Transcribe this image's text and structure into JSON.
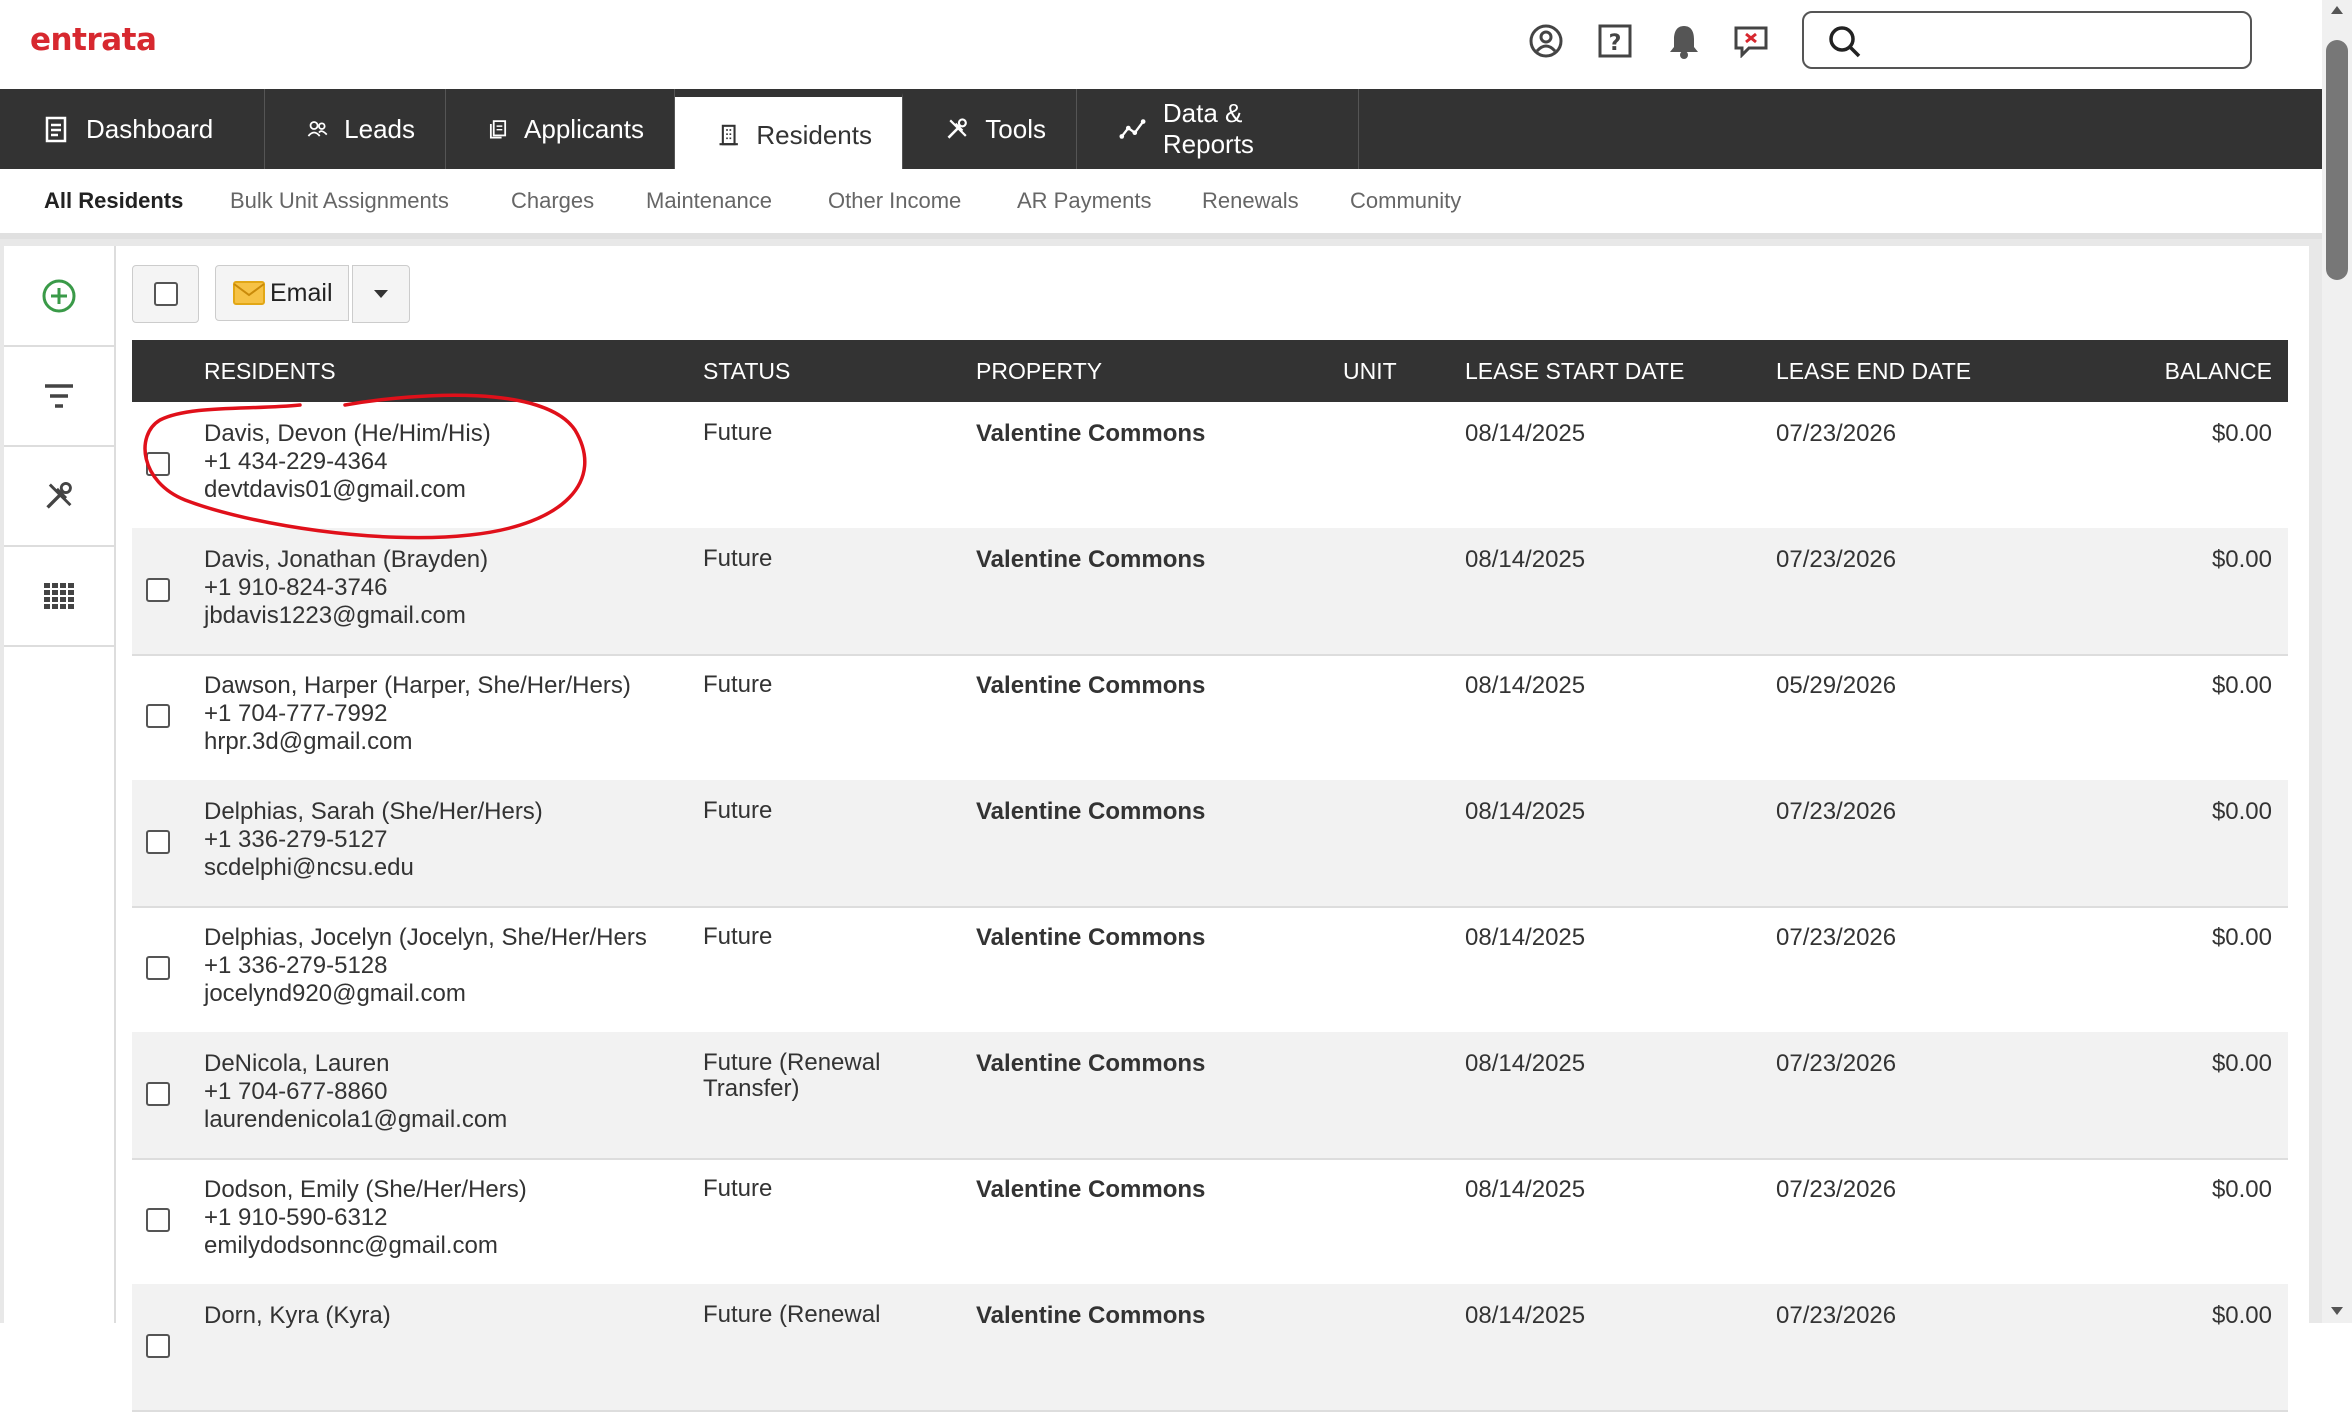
{
  "brand": {
    "logo_text": "entrata",
    "logo_color": "#d7282f"
  },
  "top_icons": [
    "user-circle-icon",
    "help-icon",
    "bell-icon",
    "feedback-icon",
    "search-icon"
  ],
  "search": {
    "placeholder": ""
  },
  "main_nav": [
    {
      "label": "Dashboard",
      "icon": "clipboard-icon",
      "active": false
    },
    {
      "label": "Leads",
      "icon": "people-icon",
      "active": false
    },
    {
      "label": "Applicants",
      "icon": "documents-icon",
      "active": false
    },
    {
      "label": "Residents",
      "icon": "building-icon",
      "active": true
    },
    {
      "label": "Tools",
      "icon": "tools-icon",
      "active": false
    },
    {
      "label": "Data & Reports",
      "icon": "chart-line-icon",
      "active": false
    }
  ],
  "sub_nav": [
    {
      "label": "All Residents",
      "active": true
    },
    {
      "label": "Bulk Unit Assignments"
    },
    {
      "label": "Charges"
    },
    {
      "label": "Maintenance"
    },
    {
      "label": "Other Income"
    },
    {
      "label": "AR Payments"
    },
    {
      "label": "Renewals"
    },
    {
      "label": "Community"
    }
  ],
  "sidebar": [
    "add-circle-icon",
    "filter-icon",
    "tools-icon",
    "columns-icon"
  ],
  "toolbar": {
    "email_label": "Email"
  },
  "table": {
    "headers": [
      "RESIDENTS",
      "STATUS",
      "PROPERTY",
      "UNIT",
      "LEASE START DATE",
      "LEASE END DATE",
      "BALANCE"
    ],
    "rows": [
      {
        "name": "Davis, Devon (He/Him/His)",
        "phone": "+1 434-229-4364",
        "email": "devtdavis01@gmail.com",
        "status": "Future",
        "property": "Valentine Commons",
        "unit": "",
        "lease_start": "08/14/2025",
        "lease_end": "07/23/2026",
        "balance": "$0.00"
      },
      {
        "name": "Davis, Jonathan (Brayden)",
        "phone": "+1 910-824-3746",
        "email": "jbdavis1223@gmail.com",
        "status": "Future",
        "property": "Valentine Commons",
        "unit": "",
        "lease_start": "08/14/2025",
        "lease_end": "07/23/2026",
        "balance": "$0.00"
      },
      {
        "name": "Dawson, Harper (Harper, She/Her/Hers)",
        "phone": "+1 704-777-7992",
        "email": "hrpr.3d@gmail.com",
        "status": "Future",
        "property": "Valentine Commons",
        "unit": "",
        "lease_start": "08/14/2025",
        "lease_end": "05/29/2026",
        "balance": "$0.00"
      },
      {
        "name": "Delphias, Sarah (She/Her/Hers)",
        "phone": "+1 336-279-5127",
        "email": "scdelphi@ncsu.edu",
        "status": "Future",
        "property": "Valentine Commons",
        "unit": "",
        "lease_start": "08/14/2025",
        "lease_end": "07/23/2026",
        "balance": "$0.00"
      },
      {
        "name": "Delphias, Jocelyn (Jocelyn, She/Her/Hers",
        "phone": "+1 336-279-5128",
        "email": "jocelynd920@gmail.com",
        "status": "Future",
        "property": "Valentine Commons",
        "unit": "",
        "lease_start": "08/14/2025",
        "lease_end": "07/23/2026",
        "balance": "$0.00"
      },
      {
        "name": "DeNicola, Lauren",
        "phone": "+1 704-677-8860",
        "email": "laurendenicola1@gmail.com",
        "status": "Future (Renewal Transfer)",
        "property": "Valentine Commons",
        "unit": "",
        "lease_start": "08/14/2025",
        "lease_end": "07/23/2026",
        "balance": "$0.00"
      },
      {
        "name": "Dodson, Emily (She/Her/Hers)",
        "phone": "+1 910-590-6312",
        "email": "emilydodsonnc@gmail.com",
        "status": "Future",
        "property": "Valentine Commons",
        "unit": "",
        "lease_start": "08/14/2025",
        "lease_end": "07/23/2026",
        "balance": "$0.00"
      },
      {
        "name": "Dorn, Kyra (Kyra)",
        "phone": "",
        "email": "",
        "status": "Future (Renewal",
        "property": "Valentine Commons",
        "unit": "",
        "lease_start": "08/14/2025",
        "lease_end": "07/23/2026",
        "balance": "$0.00"
      }
    ]
  },
  "annotation": {
    "color": "#e0101a"
  }
}
